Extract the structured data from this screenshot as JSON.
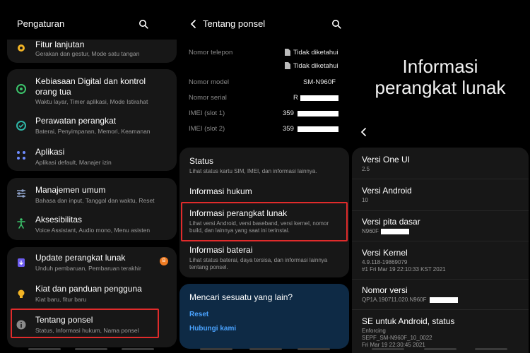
{
  "panel1": {
    "title": "Pengaturan",
    "items": [
      {
        "title": "Fitur lanjutan",
        "subtitle": "Gerakan dan gestur, Mode satu tangan"
      },
      {
        "title": "Kebiasaan Digital dan kontrol",
        "title2": "orang tua",
        "subtitle": "Waktu layar, Timer aplikasi, Mode Istirahat"
      },
      {
        "title": "Perawatan perangkat",
        "subtitle": "Baterai, Penyimpanan, Memori, Keamanan"
      },
      {
        "title": "Aplikasi",
        "subtitle": "Aplikasi default, Manajer izin"
      },
      {
        "title": "Manajemen umum",
        "subtitle": "Bahasa dan input, Tanggal dan waktu, Reset"
      },
      {
        "title": "Aksesibilitas",
        "subtitle": "Voice Assistant, Audio mono, Menu asisten"
      },
      {
        "title": "Update perangkat lunak",
        "subtitle": "Unduh pembaruan, Pembaruan terakhir",
        "badge": "B"
      },
      {
        "title": "Kiat dan panduan pengguna",
        "subtitle": "Kiat baru, fitur baru"
      },
      {
        "title": "Tentang ponsel",
        "subtitle": "Status, Informasi hukum, Nama ponsel"
      }
    ]
  },
  "panel2": {
    "title": "Tentang ponsel",
    "info": [
      {
        "label": "Nomor telepon",
        "value": "Tidak diketahui"
      },
      {
        "label": "",
        "value": "Tidak diketahui"
      },
      {
        "label": "Nomor model",
        "value": "SM-N960F"
      },
      {
        "label": "Nomor serial",
        "value": "R"
      },
      {
        "label": "IMEI (slot 1)",
        "value": "359"
      },
      {
        "label": "IMEI (slot 2)",
        "value": "359"
      }
    ],
    "menu": [
      {
        "title": "Status",
        "subtitle": "Lihat status kartu SIM, IMEI, dan informasi lainnya."
      },
      {
        "title": "Informasi hukum",
        "subtitle": ""
      },
      {
        "title": "Informasi perangkat lunak",
        "subtitle": "Lihat versi Android, versi baseband, versi kernel, nomor",
        "subtitle2": "build, dan lainnya yang saat ini terinstal."
      },
      {
        "title": "Informasi baterai",
        "subtitle": "Lihat status baterai, daya tersisa, dan informasi lainnya",
        "subtitle2": "tentang ponsel."
      }
    ],
    "looking": {
      "title": "Mencari sesuatu yang lain?",
      "link1": "Reset",
      "link2": "Hubungi kami"
    }
  },
  "panel3": {
    "heading1": "Informasi",
    "heading2": "perangkat lunak",
    "items": [
      {
        "title": "Versi One UI",
        "value": "2.5"
      },
      {
        "title": "Versi Android",
        "value": "10"
      },
      {
        "title": "Versi pita dasar",
        "value": "N960F"
      },
      {
        "title": "Versi Kernel",
        "value": "4.9.118-19869079",
        "value2": "#1 Fri Mar 19 22:10:33 KST 2021"
      },
      {
        "title": "Nomor versi",
        "value": "QP1A.190711.020.N960F"
      },
      {
        "title": "SE untuk Android, status",
        "value": "Enforcing",
        "value2": "SEPF_SM-N960F_10_0022",
        "value3": "Fri Mar 19 22:30:45 2021"
      }
    ]
  },
  "colors": {
    "background": "#000000",
    "card": "#171717",
    "highlight_border": "#e02b2b",
    "link": "#4aa3ff",
    "looking_card": "#0e2a45"
  }
}
